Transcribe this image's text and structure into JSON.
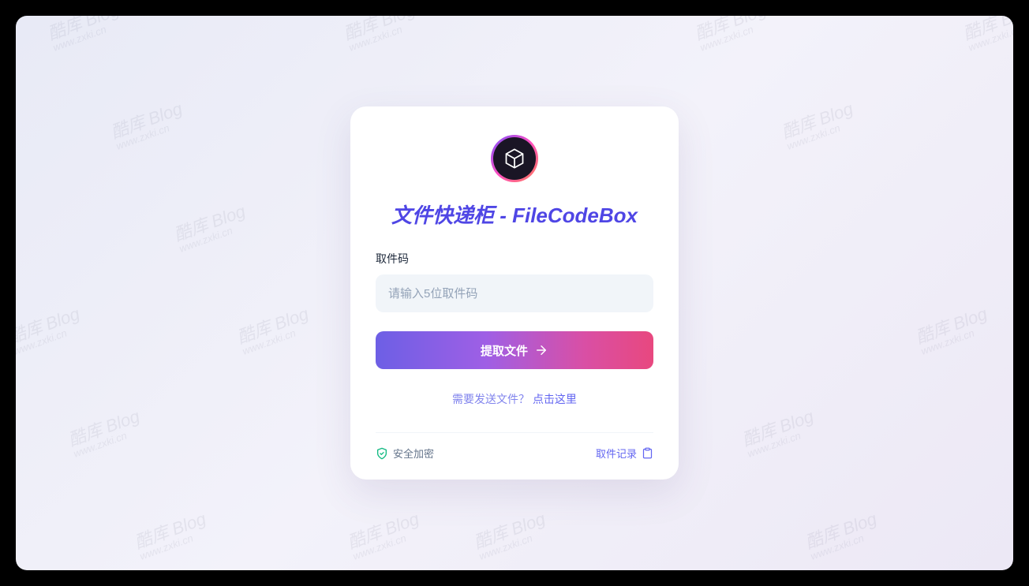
{
  "watermark": {
    "main": "酷库 Blog",
    "sub": "www.zxki.cn"
  },
  "card": {
    "title": "文件快递柜 - FileCodeBox",
    "label": "取件码",
    "placeholder": "请输入5位取件码",
    "submit": "提取文件",
    "sendLink": {
      "question": "需要发送文件？",
      "action": "点击这里"
    },
    "secure": "安全加密",
    "history": "取件记录"
  }
}
